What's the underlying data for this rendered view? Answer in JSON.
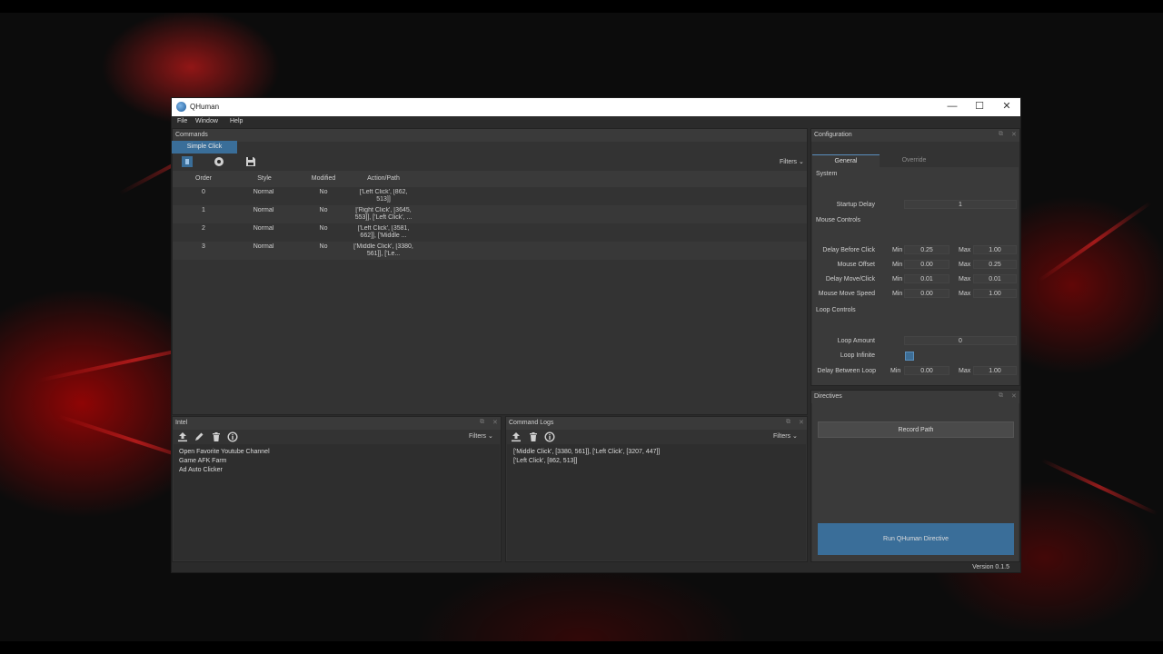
{
  "window": {
    "title": "QHuman",
    "min": "—",
    "max": "☐",
    "close": "✕"
  },
  "menu": [
    "File",
    "Window",
    "Help"
  ],
  "commands": {
    "title": "Commands",
    "tab": "Simple Click",
    "filters": "Filters",
    "columns": [
      "Order",
      "Style",
      "Modified",
      "Action/Path"
    ],
    "rows": [
      {
        "order": "0",
        "style": "Normal",
        "modified": "No",
        "action": "['Left Click', [862, 513]]"
      },
      {
        "order": "1",
        "style": "Normal",
        "modified": "No",
        "action": "['Right Click', [3645, 553]], ['Left Click', ..."
      },
      {
        "order": "2",
        "style": "Normal",
        "modified": "No",
        "action": "['Left Click', [3581, 662]], ['Middle ..."
      },
      {
        "order": "3",
        "style": "Normal",
        "modified": "No",
        "action": "['Middle Click', [3380, 561]], ['Le..."
      }
    ]
  },
  "configuration": {
    "title": "Configuration",
    "tabs": [
      "General",
      "Override"
    ],
    "system_label": "System",
    "startup_delay_label": "Startup Delay",
    "startup_delay": "1",
    "mouse_controls_label": "Mouse Controls",
    "min_label": "Min",
    "max_label": "Max",
    "mouse_rows": [
      {
        "label": "Delay Before Click",
        "min": "0.25",
        "max": "1.00"
      },
      {
        "label": "Mouse Offset",
        "min": "0.00",
        "max": "0.25"
      },
      {
        "label": "Delay Move/Click",
        "min": "0.01",
        "max": "0.01"
      },
      {
        "label": "Mouse Move Speed",
        "min": "0.00",
        "max": "1.00"
      }
    ],
    "loop_controls_label": "Loop Controls",
    "loop_amount_label": "Loop Amount",
    "loop_amount": "0",
    "loop_infinite_label": "Loop Infinite",
    "delay_between_loop_label": "Delay Between Loop",
    "delay_between_loop_min": "0.00",
    "delay_between_loop_max": "1.00"
  },
  "directives": {
    "title": "Directives",
    "record_path": "Record Path",
    "run": "Run QHuman  Directive"
  },
  "intel": {
    "title": "Intel",
    "filters": "Filters",
    "items": [
      "Open Favorite Youtube Channel",
      "Game AFK Farm",
      "Ad Auto Clicker"
    ]
  },
  "command_logs": {
    "title": "Command Logs",
    "filters": "Filters",
    "items": [
      "['Middle Click', [3380, 561]], ['Left Click', [3207, 447]]",
      "['Left Click', [862, 513]]"
    ]
  },
  "status": {
    "version": "Version 0.1.5"
  },
  "colors": {
    "accent": "#3a6e99",
    "panel": "#333333",
    "checkbox": "#3d6d95"
  }
}
